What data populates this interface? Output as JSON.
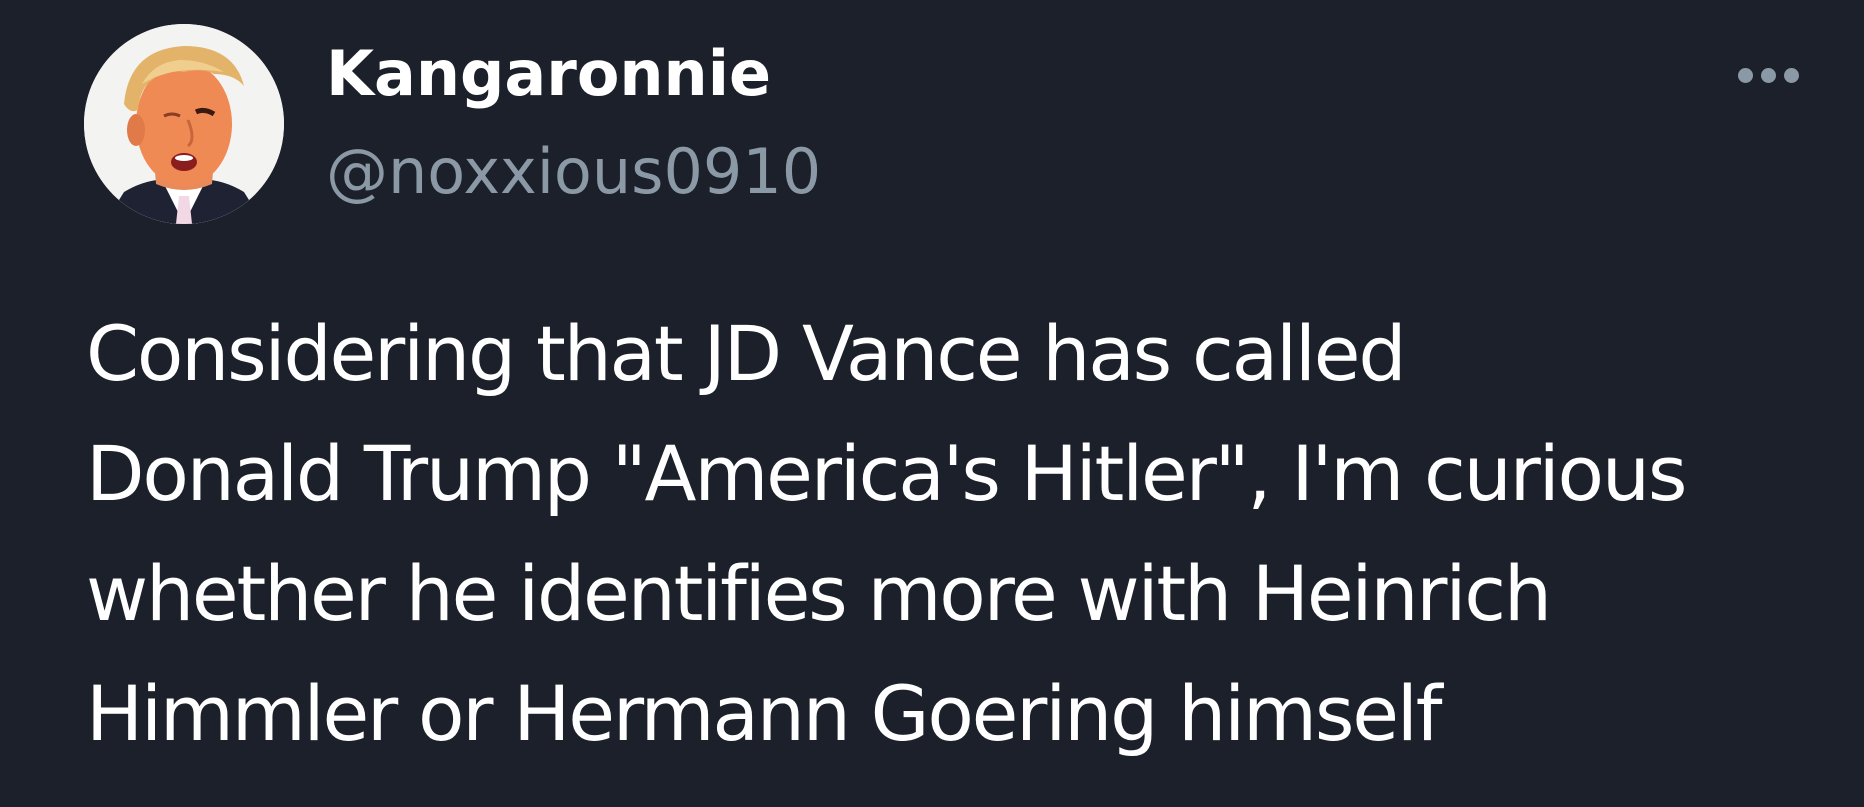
{
  "author": {
    "display_name": "Kangaronnie",
    "handle": "@noxxious0910",
    "avatar_icon": "caricature-portrait"
  },
  "more_menu": {
    "icon": "more-horizontal-icon"
  },
  "tweet": {
    "lines": [
      "Considering that JD Vance has called",
      "Donald Trump \"America's Hitler\", I'm curious",
      "whether he identifies more with Heinrich",
      "Himmler or Hermann Goering himself"
    ]
  },
  "colors": {
    "background": "#1b202a",
    "text_primary": "#ffffff",
    "text_secondary": "#8b98a5"
  }
}
